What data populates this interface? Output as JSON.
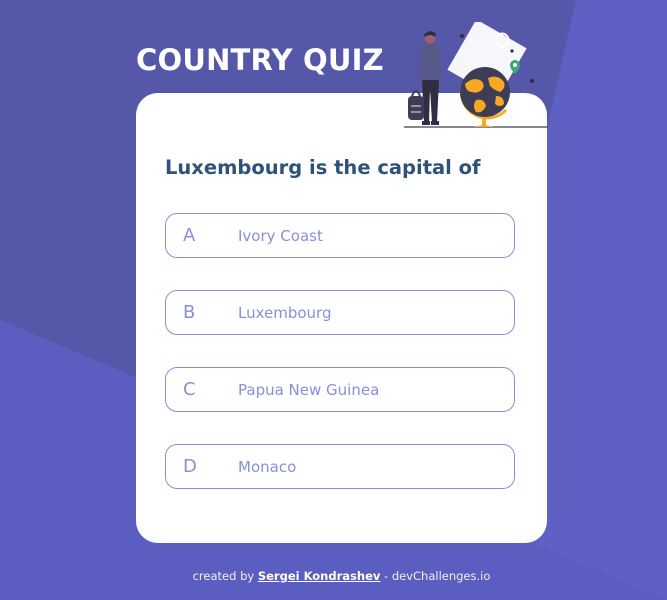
{
  "app": {
    "title": "COUNTRY QUIZ"
  },
  "colors": {
    "background": "#5557a8",
    "accent": "#8b8edb",
    "question_text": "#2f527b",
    "card": "#ffffff"
  },
  "quiz": {
    "question": "Luxembourg is the capital of",
    "options": [
      {
        "letter": "A",
        "text": "Ivory Coast"
      },
      {
        "letter": "B",
        "text": "Luxembourg"
      },
      {
        "letter": "C",
        "text": "Papua New Guinea"
      },
      {
        "letter": "D",
        "text": "Monaco"
      }
    ]
  },
  "footer": {
    "prefix": "created by",
    "author": "Sergei Kondrashev",
    "suffix": "- devChallenges.io"
  },
  "icons": {
    "illustration": "traveler-with-globe-icon"
  }
}
